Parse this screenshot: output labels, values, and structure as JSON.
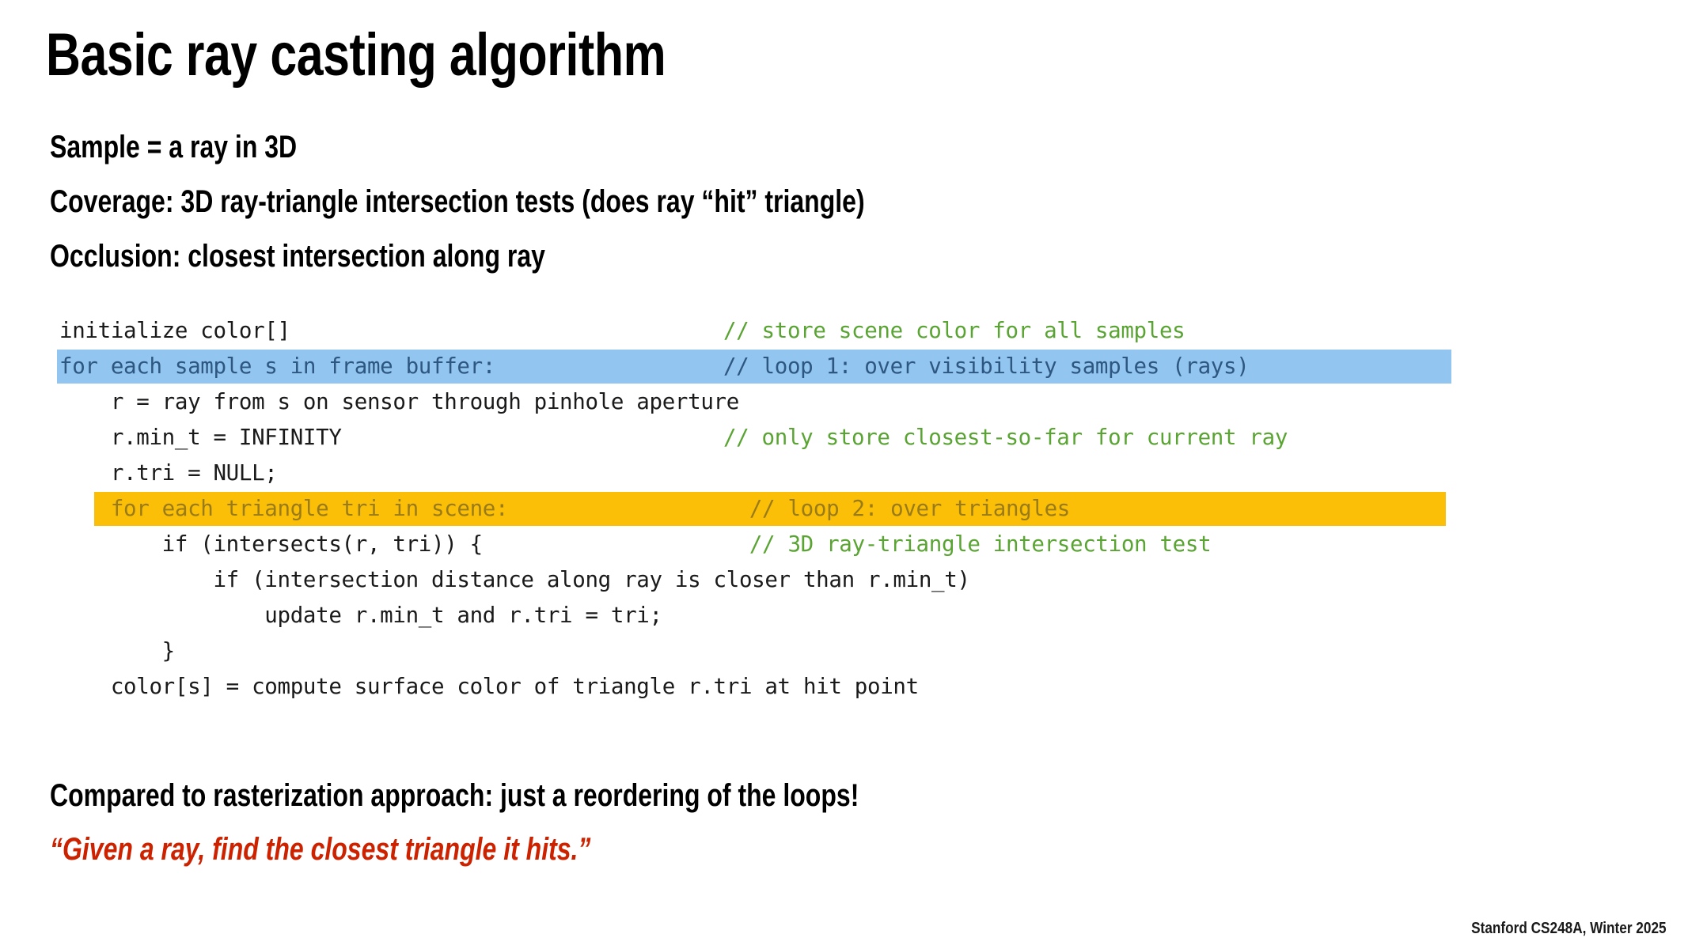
{
  "slide": {
    "title": "Basic ray casting algorithm",
    "bullets": [
      "Sample = a ray in 3D",
      "Coverage: 3D ray-triangle intersection tests  (does ray “hit” triangle)",
      "Occlusion: closest intersection along ray"
    ],
    "summary": "Compared to rasterization approach: just a reordering of the loops!",
    "quote": "“Given a ray, find the closest triangle it hits.”",
    "footer": "Stanford CS248A, Winter 2025"
  },
  "colors": {
    "highlight_blue": "#92c5f0",
    "highlight_orange": "#fbbf07",
    "comment_green": "#5aa434",
    "comment_navy": "#2d5780",
    "comment_brown": "#9a7b1a",
    "quote_red": "#cc2200",
    "code_text": "#1a1a1a",
    "background": "#ffffff"
  },
  "code": {
    "lines": [
      {
        "code": "initialize color[]",
        "comment": "// store scene color for all samples",
        "comment_col": 51,
        "highlight": "none",
        "code_style": "plain",
        "comment_style": "green"
      },
      {
        "code": "for each sample s in frame buffer:",
        "comment": "// loop 1: over visibility samples (rays)",
        "comment_col": 51,
        "highlight": "blue",
        "code_style": "navy",
        "comment_style": "navy"
      },
      {
        "code": "    r = ray from s on sensor through pinhole aperture",
        "comment": "",
        "comment_col": 51,
        "highlight": "none",
        "code_style": "plain",
        "comment_style": "green"
      },
      {
        "code": "    r.min_t = INFINITY",
        "comment": "// only store closest-so-far for current ray",
        "comment_col": 51,
        "highlight": "none",
        "code_style": "plain",
        "comment_style": "green"
      },
      {
        "code": "    r.tri = NULL;",
        "comment": "",
        "comment_col": 51,
        "highlight": "none",
        "code_style": "plain",
        "comment_style": "green"
      },
      {
        "code": "    for each triangle tri in scene:",
        "comment": "// loop 2: over triangles",
        "comment_col": 53,
        "highlight": "orange",
        "code_style": "brown",
        "comment_style": "brown"
      },
      {
        "code": "        if (intersects(r, tri)) {",
        "comment": "// 3D ray-triangle intersection test",
        "comment_col": 53,
        "highlight": "none",
        "code_style": "plain",
        "comment_style": "green"
      },
      {
        "code": "            if (intersection distance along ray is closer than r.min_t)",
        "comment": "",
        "comment_col": 53,
        "highlight": "none",
        "code_style": "plain",
        "comment_style": "green"
      },
      {
        "code": "                update r.min_t and r.tri = tri;",
        "comment": "",
        "comment_col": 53,
        "highlight": "none",
        "code_style": "plain",
        "comment_style": "green"
      },
      {
        "code": "        }",
        "comment": "",
        "comment_col": 53,
        "highlight": "none",
        "code_style": "plain",
        "comment_style": "green"
      },
      {
        "code": "    color[s] = compute surface color of triangle r.tri at hit point",
        "comment": "",
        "comment_col": 53,
        "highlight": "none",
        "code_style": "plain",
        "comment_style": "green"
      }
    ]
  }
}
